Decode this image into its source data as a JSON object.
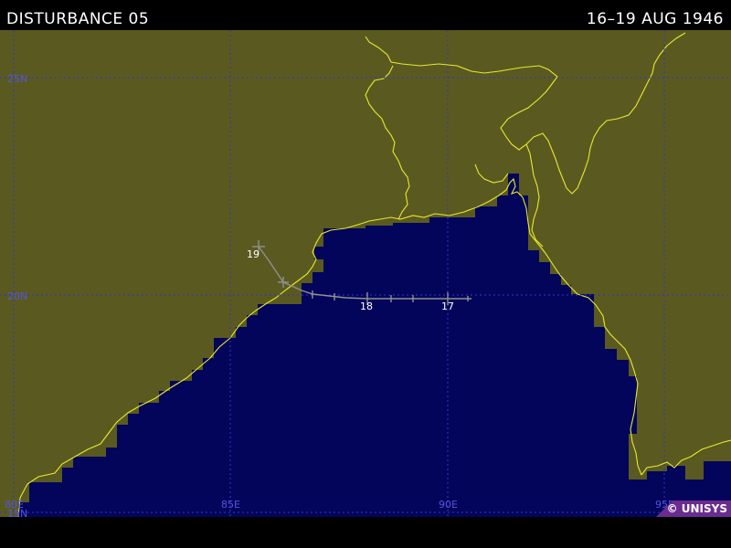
{
  "header": {
    "title": "DISTURBANCE 05",
    "date_range": "16–19 AUG 1946"
  },
  "map": {
    "colors": {
      "land": "#5a5a20",
      "sea": "#03055a",
      "coast": "#e8e832",
      "grid": "#3333cc",
      "track": "#909090",
      "grid_label": "#5555dd"
    },
    "lat_labels": [
      "25N",
      "20N",
      "15N"
    ],
    "lon_labels": [
      "80E",
      "85E",
      "90E",
      "95E"
    ],
    "track_date_labels": [
      "19",
      "18",
      "17"
    ]
  },
  "credit": {
    "logo_text": "© UNISYS"
  }
}
